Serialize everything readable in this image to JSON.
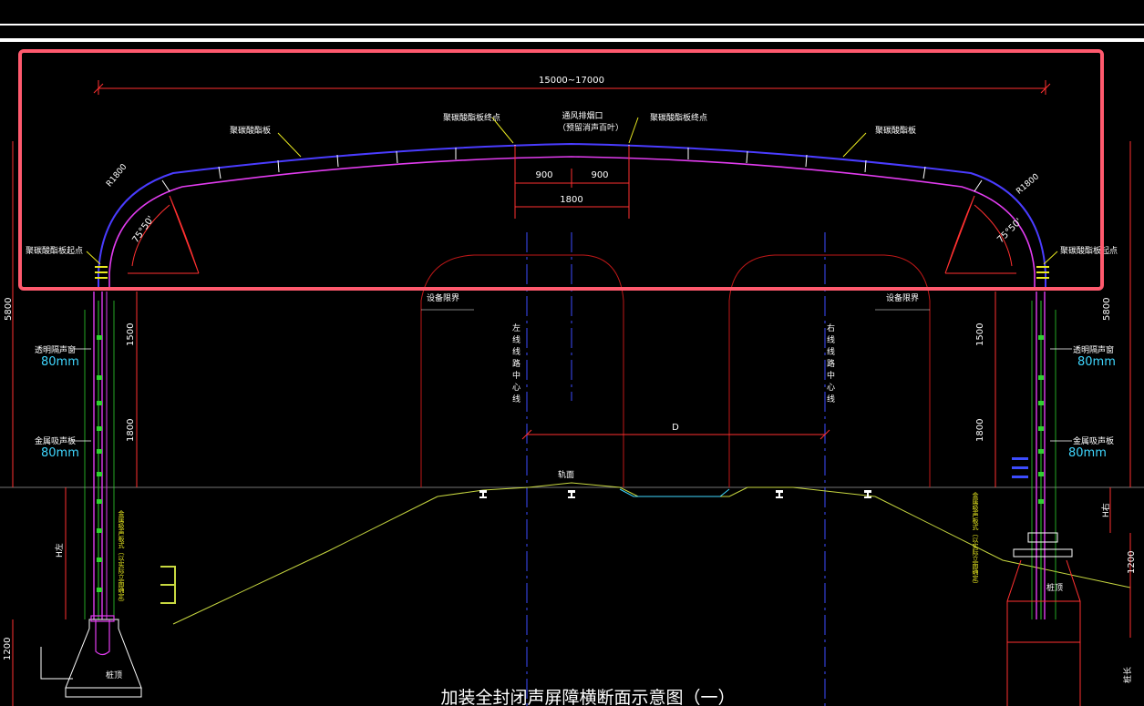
{
  "colors": {
    "background": "#000000",
    "arch_outer": "#4a3cff",
    "arch_inner": "#e23cf0",
    "dimension": "#ff3030",
    "leader": "#e8e820",
    "label_white": "#ffffff",
    "label_cyan": "#3fd7ff",
    "axis_blue": "#3c4cff",
    "ground": "#c8d840",
    "green_bolts": "#2fd02f",
    "selection": "#ff5a6e",
    "frame_line": "#ffffff"
  },
  "dimensions": {
    "span": "15000~17000",
    "half_left": "900",
    "half_right": "900",
    "width_center": "1800",
    "radius_left": "R1800",
    "radius_right": "R1800",
    "angle_left": "75°50'",
    "angle_right": "75°50'",
    "height_left": "5800",
    "height_right": "5800",
    "h1500_left": "1500",
    "h1800_left": "1800",
    "h1500_right": "1500",
    "h1800_right": "1800",
    "h1200_left": "1200",
    "h1200_right": "1200",
    "D": "D",
    "h_left": "H左",
    "h_right": "H右"
  },
  "labels": {
    "pc_board_left": "聚碳酸酯板",
    "pc_board_right": "聚碳酸酯板",
    "pc_end_left": "聚碳酸酯板终点",
    "pc_end_right": "聚碳酸酯板终点",
    "vent": "通风排烟口",
    "vent_sub": "（预留消声百叶）",
    "pc_start_left": "聚碳酸酯板起点",
    "pc_start_right": "聚碳酸酯板起点",
    "equip_left": "设备限界",
    "equip_right": "设备限界",
    "left_center": "左线线路中心线",
    "right_center": "右线线路中心线",
    "rail_surface": "轨面",
    "transparent_left": "透明隔声窗",
    "transparent_left_thk": "80mm",
    "transparent_right": "透明隔声窗",
    "transparent_right_thk": "80mm",
    "metal_left": "金属吸声板",
    "metal_left_thk": "80mm",
    "metal_right": "金属吸声板",
    "metal_right_thk": "80mm",
    "pile_left": "桩顶",
    "pile_right": "桩顶",
    "col_note_left": "金属吸声板式（以实际立面确定）",
    "col_note_right": "金属吸声板式（以实际立面确定）",
    "pile_side": "桩长",
    "caption": "加装全封闭声屏障横断面示意图（一）"
  }
}
